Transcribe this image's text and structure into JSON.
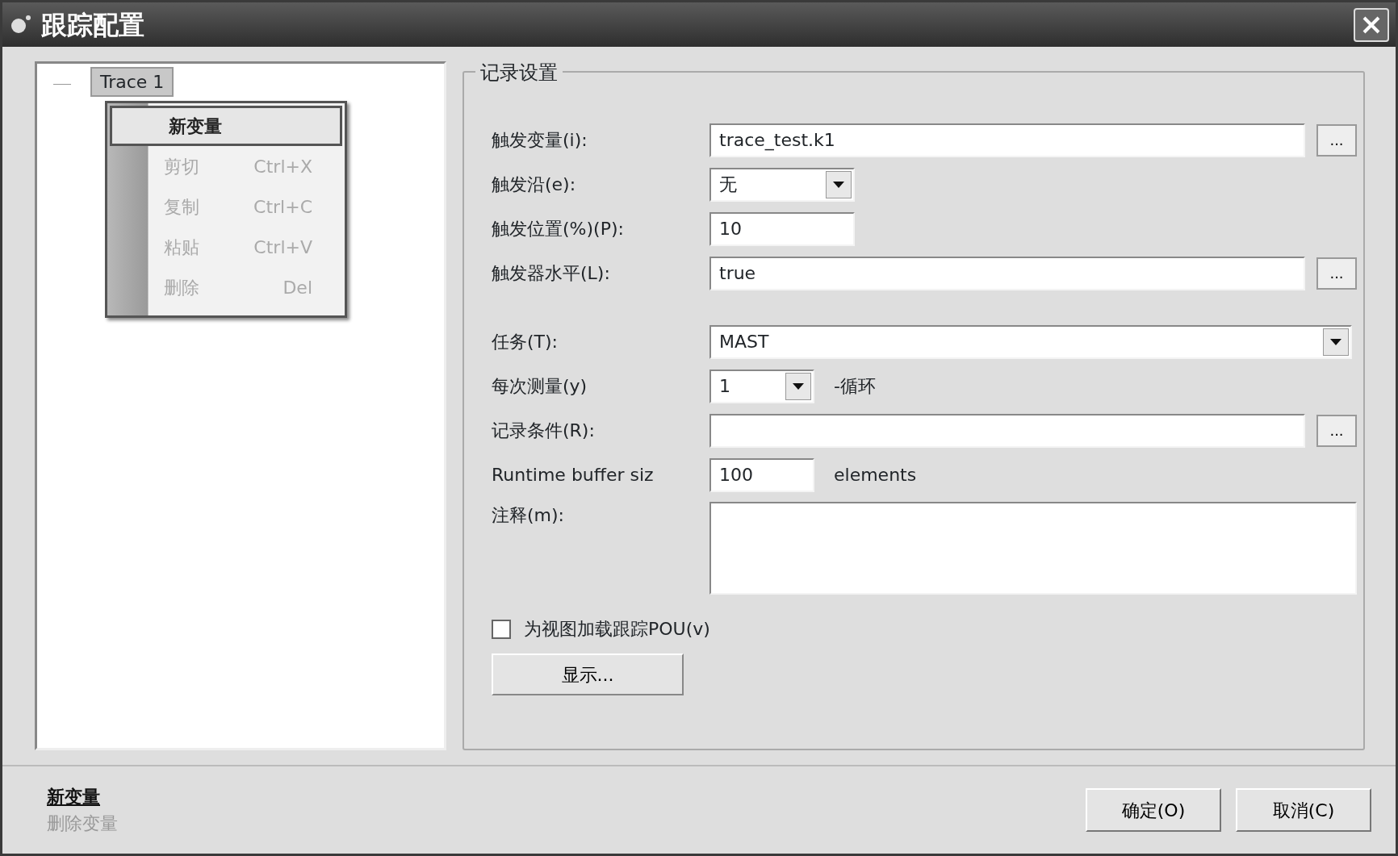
{
  "window": {
    "title": "跟踪配置"
  },
  "tree": {
    "items": [
      {
        "label": "Trace 1",
        "selected": true
      }
    ]
  },
  "context_menu": {
    "items": [
      {
        "label": "新变量",
        "disabled": false,
        "highlighted": true
      },
      {
        "label": "剪切",
        "shortcut": "Ctrl+X",
        "disabled": true,
        "highlighted": false
      },
      {
        "label": "复制",
        "shortcut": "Ctrl+C",
        "disabled": true,
        "highlighted": false
      },
      {
        "label": "粘贴",
        "shortcut": "Ctrl+V",
        "disabled": true,
        "highlighted": false
      },
      {
        "label": "删除",
        "shortcut": "Del",
        "disabled": true,
        "highlighted": false
      }
    ]
  },
  "record_settings": {
    "title": "记录设置",
    "fields": [
      {
        "kind": "browse",
        "label": "触发变量(i):",
        "value": "trace_test.k1",
        "browse": "..."
      },
      {
        "kind": "dropdown",
        "label": "触发沿(e):",
        "value": "无"
      },
      {
        "kind": "text",
        "label": "触发位置(%)(P):",
        "value": "10"
      },
      {
        "kind": "browse",
        "label": "触发器水平(L):",
        "value": "true",
        "browse": "..."
      },
      {
        "kind": "wide-dropdown",
        "label": "任务(T):",
        "value": "MAST"
      },
      {
        "kind": "small-dropdown",
        "label": "每次测量(y)",
        "value": "1",
        "suffix": "-循环"
      },
      {
        "kind": "browse",
        "label": "记录条件(R):",
        "browse": "..."
      },
      {
        "kind": "small-text",
        "label": "Runtime  buffer siz",
        "value": "100",
        "suffix": "elements"
      },
      {
        "kind": "textarea",
        "label": "注释(m):"
      }
    ],
    "checkbox": {
      "label": "为视图加载跟踪POU(v)",
      "checked": false
    },
    "show_button": "显示..."
  },
  "footer": {
    "links": [
      {
        "label": "新变量",
        "disabled": false
      },
      {
        "label": "删除变量",
        "disabled": true
      }
    ],
    "buttons": [
      "确定(O)",
      "取消(C)"
    ]
  }
}
